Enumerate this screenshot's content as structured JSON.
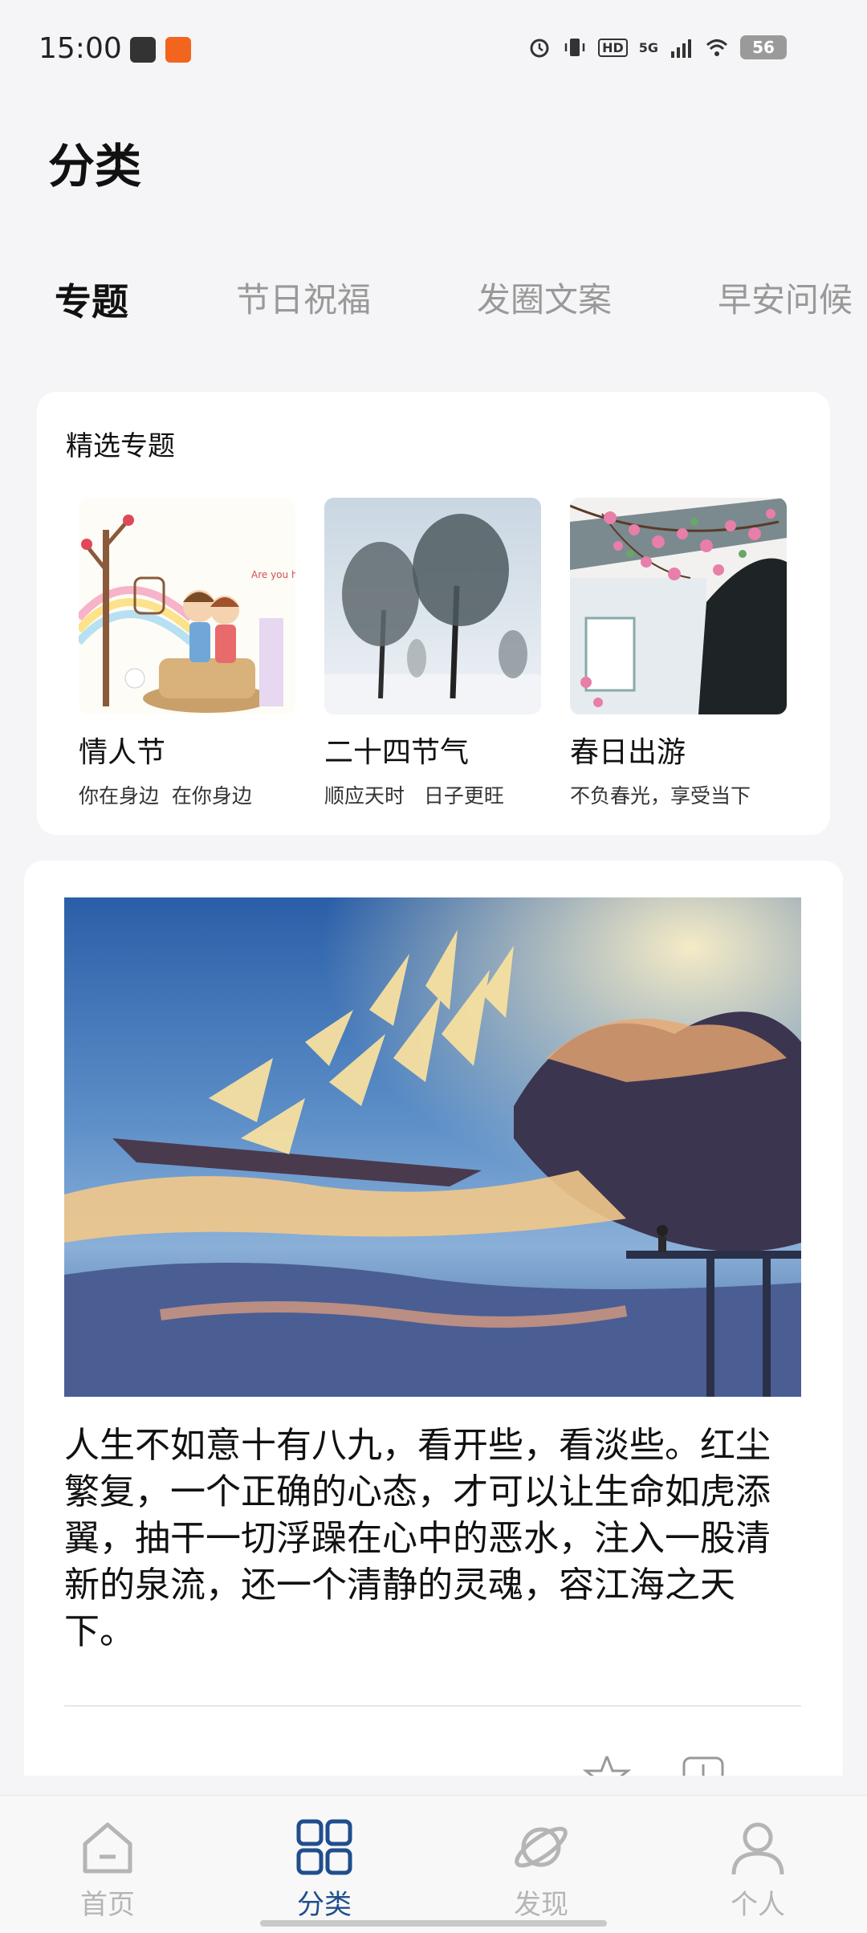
{
  "status_bar": {
    "time": "15:00",
    "hd_badge": "HD",
    "network": "5G",
    "battery": "56",
    "icons": [
      "gallery-icon",
      "app-icon",
      "alarm-icon",
      "vibrate-icon",
      "hd-icon",
      "signal-icon",
      "wifi-icon",
      "battery-icon"
    ]
  },
  "page": {
    "title": "分类"
  },
  "tabs": [
    {
      "label": "专题",
      "active": true
    },
    {
      "label": "节日祝福",
      "active": false
    },
    {
      "label": "发圈文案",
      "active": false
    },
    {
      "label": "早安问候",
      "active": false
    }
  ],
  "featured": {
    "title": "精选专题",
    "topics": [
      {
        "name": "情人节",
        "subtitle": "你在身边  在你身边",
        "image": "couple-illustration"
      },
      {
        "name": "二十四节气",
        "subtitle": "顺应天时   日子更旺",
        "image": "frosted-trees"
      },
      {
        "name": "春日出游",
        "subtitle": "不负春光，享受当下",
        "image": "spring-blossoms"
      }
    ]
  },
  "post": {
    "image": "flying-sailship-sunset",
    "text": "人生不如意十有八九，看开些，看淡些。红尘繁复，一个正确的心态，才可以让生命如虎添翼，抽干一切浮躁在心中的恶水，注入一股清新的泉流，还一个清静的灵魂，容江海之天下。",
    "actions": [
      "star-icon",
      "share-icon"
    ]
  },
  "bottom_nav": [
    {
      "label": "首页",
      "icon": "home-icon",
      "active": false
    },
    {
      "label": "分类",
      "icon": "grid-icon",
      "active": true
    },
    {
      "label": "发现",
      "icon": "planet-icon",
      "active": false
    },
    {
      "label": "个人",
      "icon": "person-icon",
      "active": false
    }
  ],
  "colors": {
    "accent": "#1f4e8c",
    "inactive": "#b5b5b5",
    "background": "#f5f5f7"
  }
}
